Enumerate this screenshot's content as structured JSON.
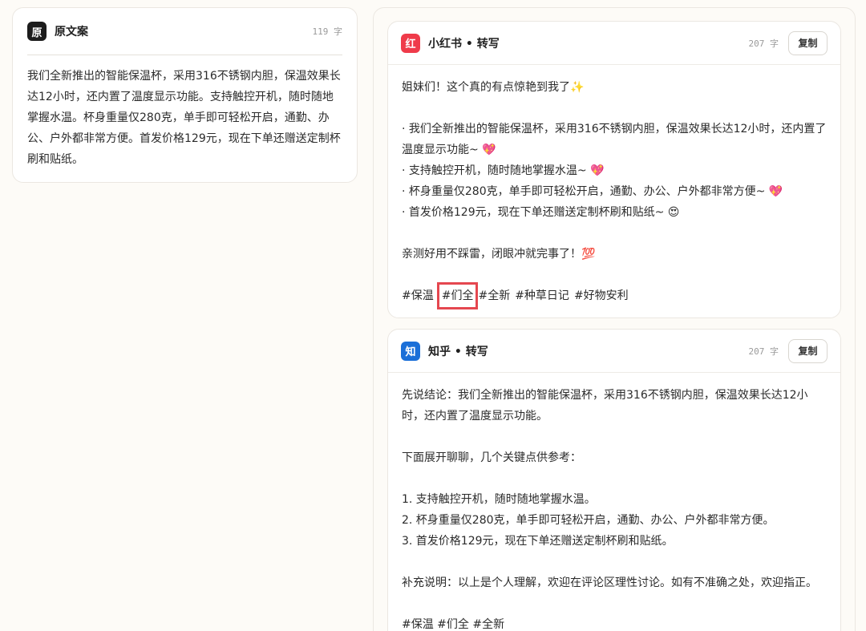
{
  "original": {
    "badge": "原",
    "title": "原文案",
    "count": "119 字",
    "lines": [
      "我们全新推出的智能保温杯，采用316不锈钢内胆，保温效果长",
      "达12小时，还内置了温度显示功能。支持触控开机，随时随地",
      "掌握水温。杯身重量仅280克，单手即可轻松开启，通勤、办",
      "公、户外都非常方便。首发价格129元，现在下单还赠送定制杯",
      "刷和贴纸。"
    ]
  },
  "xiaohongshu": {
    "badge": "红",
    "badge_color": "#ef3b4a",
    "title": "小红书 • 转写",
    "count": "207 字",
    "copy_label": "复制",
    "intro": "姐妹们！这个真的有点惊艳到我了✨",
    "bullets": [
      "· 我们全新推出的智能保温杯，采用316不锈钢内胆，保温效果长达12小时，还内置了",
      "温度显示功能~ 💖",
      "· 支持触控开机，随时随地掌握水温~ 💖",
      "· 杯身重量仅280克，单手即可轻松开启，通勤、办公、户外都非常方便~ 💖",
      "· 首发价格129元，现在下单还赠送定制杯刷和贴纸~ 😍"
    ],
    "outro": "亲测好用不踩雷，闭眼冲就完事了！💯",
    "tags": [
      "#保温",
      "#们全",
      "#全新",
      "#种草日记",
      "#好物安利"
    ]
  },
  "zhihu": {
    "badge": "知",
    "badge_color": "#1a6fd8",
    "title": "知乎 • 转写",
    "count": "207 字",
    "copy_label": "复制",
    "conclusion": [
      "先说结论：我们全新推出的智能保温杯，采用316不锈钢内胆，保温效果长达12小",
      "时，还内置了温度显示功能。"
    ],
    "expand": "下面展开聊聊，几个关键点供参考：",
    "points": [
      "1. 支持触控开机，随时随地掌握水温。",
      "2. 杯身重量仅280克，单手即可轻松开启，通勤、办公、户外都非常方便。",
      "3. 首发价格129元，现在下单还赠送定制杯刷和贴纸。"
    ],
    "note": "补充说明：以上是个人理解，欢迎在评论区理性讨论。如有不准确之处，欢迎指正。",
    "tags": "#保温 #们全 #全新"
  }
}
